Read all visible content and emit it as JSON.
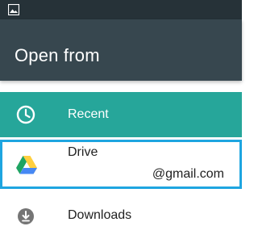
{
  "status_bar": {
    "icon": "image-notification-icon"
  },
  "app_bar": {
    "title": "Open from"
  },
  "colors": {
    "status_bar": "#263238",
    "app_bar": "#37474f",
    "selected_row": "#26a69a",
    "highlight_border": "#1ea5e0"
  },
  "list": {
    "items": [
      {
        "label": "Recent",
        "icon": "clock-icon"
      },
      {
        "label": "Drive",
        "sublabel": "@gmail.com",
        "icon": "google-drive-icon"
      },
      {
        "label": "Downloads",
        "icon": "download-icon"
      }
    ]
  }
}
